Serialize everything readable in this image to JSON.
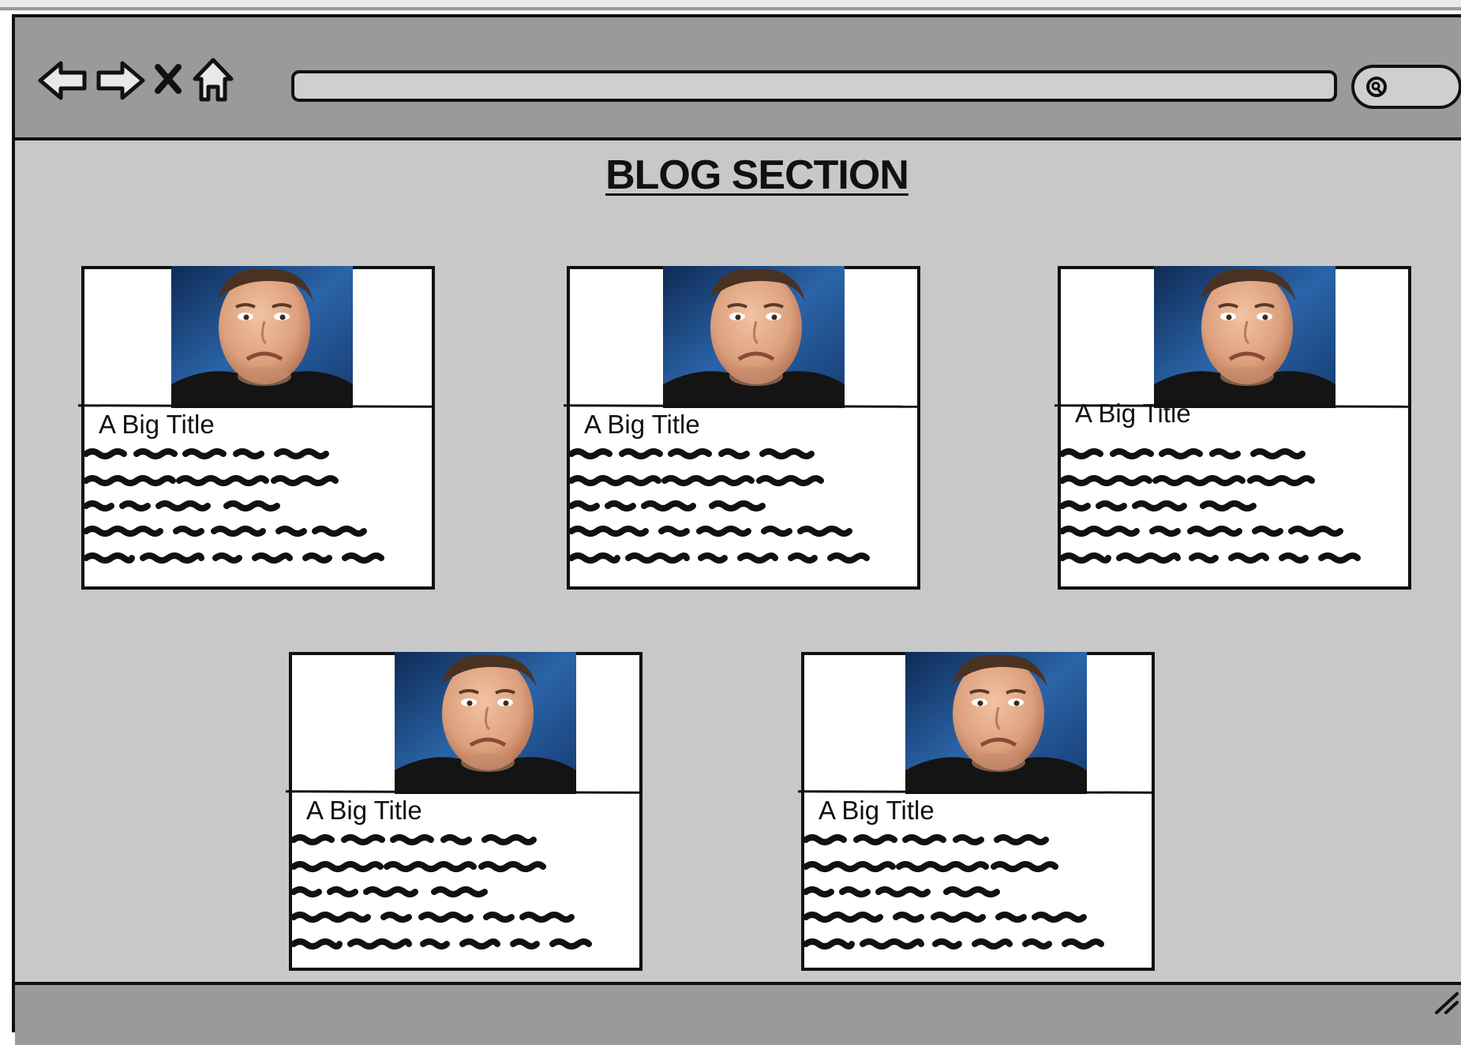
{
  "page": {
    "section_title": "BLOG SECTION"
  },
  "toolbar": {
    "icons": [
      "back-arrow-icon",
      "forward-arrow-icon",
      "close-icon",
      "home-icon",
      "search-icon"
    ],
    "address_value": ""
  },
  "posts": [
    {
      "title": "A Big Title",
      "image": "portrait-photo"
    },
    {
      "title": "A Big Title",
      "image": "portrait-photo"
    },
    {
      "title": "A Big Title",
      "image": "portrait-photo"
    },
    {
      "title": "A Big Title",
      "image": "portrait-photo"
    },
    {
      "title": "A Big Title",
      "image": "portrait-photo"
    }
  ],
  "colors": {
    "toolbar": "#9a9a9a",
    "canvas": "#c8c8c8",
    "card": "#ffffff",
    "ink": "#111111",
    "photo_bg": "#1f4f8a"
  }
}
